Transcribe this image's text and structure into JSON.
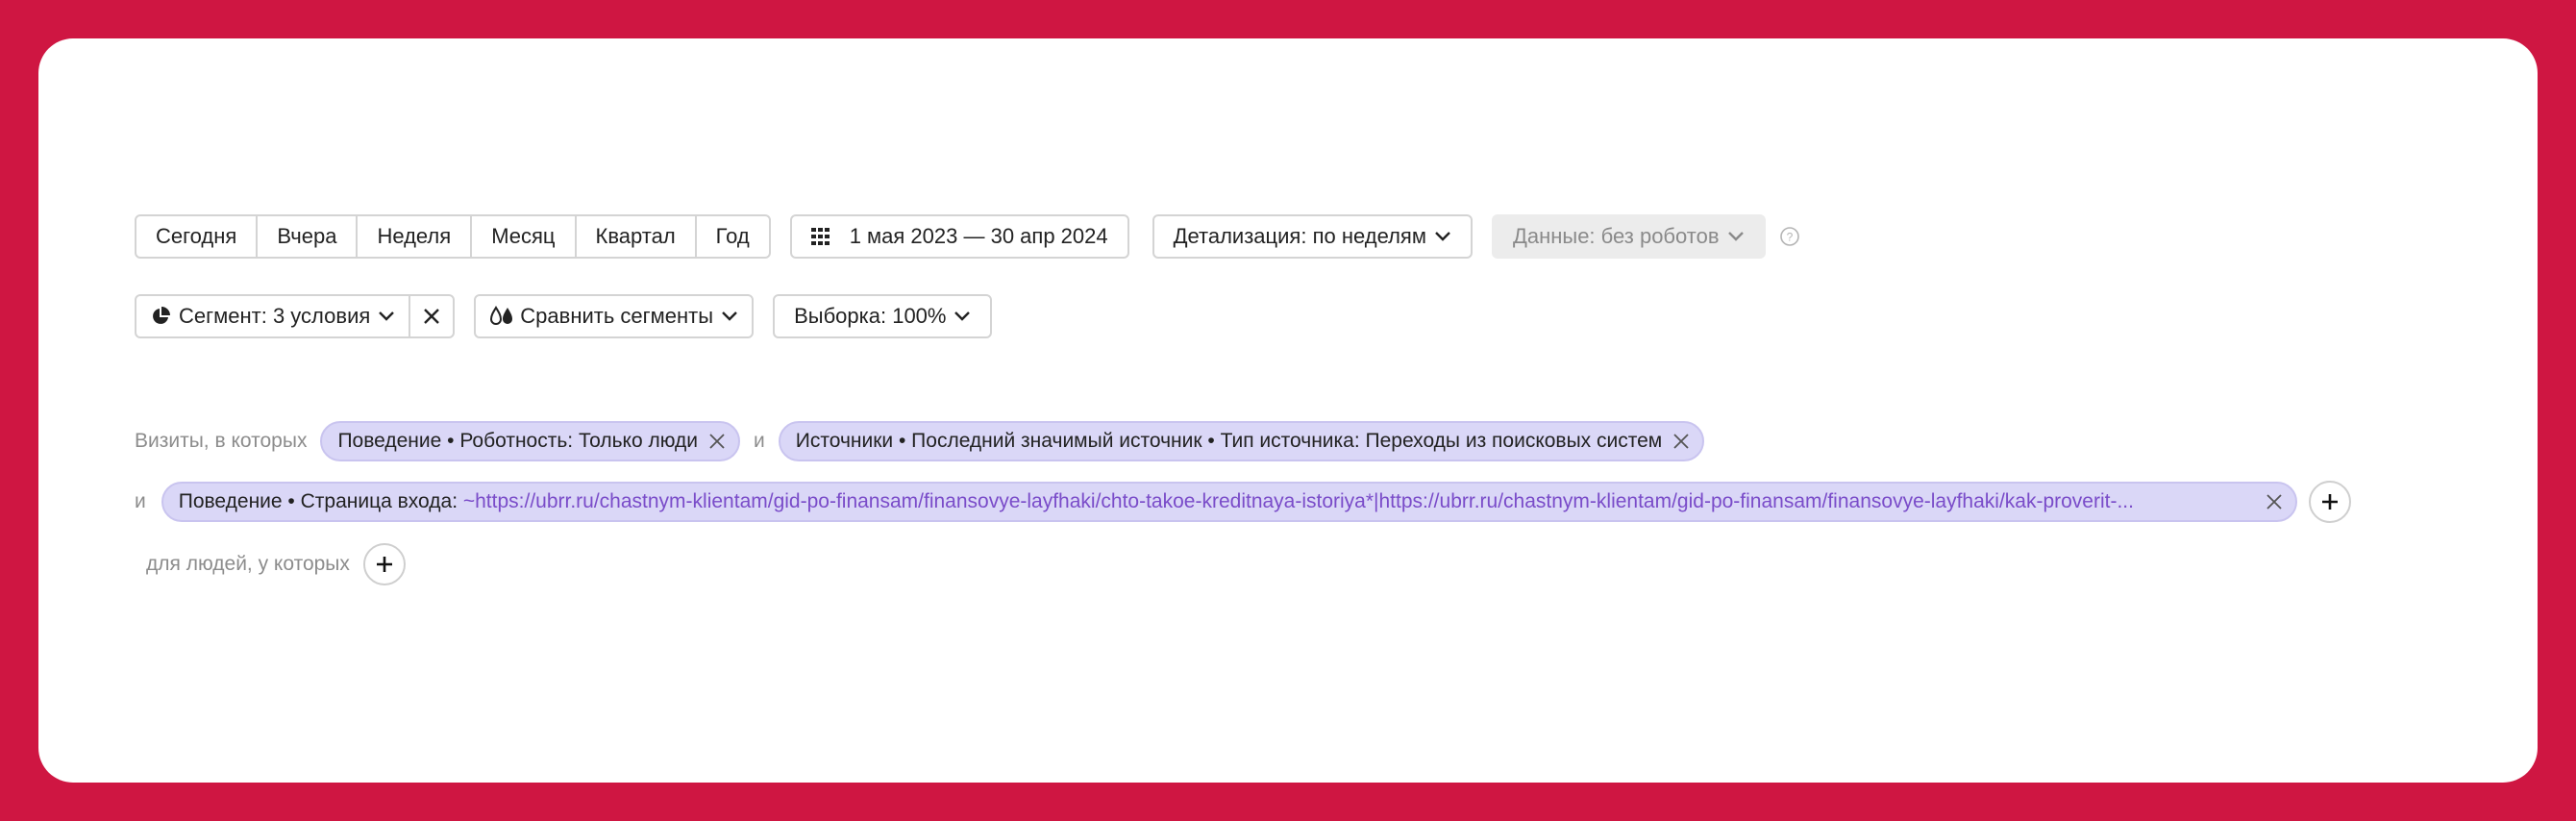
{
  "period_tabs": [
    "Сегодня",
    "Вчера",
    "Неделя",
    "Месяц",
    "Квартал",
    "Год"
  ],
  "date_range": "1 мая 2023 — 30 апр 2024",
  "detail_label": "Детализация: по неделям",
  "data_label": "Данные: без роботов",
  "segment_label": "Сегмент: 3 условия",
  "compare_label": "Сравнить сегменты",
  "sample_label": "Выборка: 100%",
  "visits_label": "Визиты, в которых",
  "and_label": "и",
  "people_label": "для людей, у которых",
  "conditions": {
    "c1": "Поведение • Роботность: Только люди",
    "c2": "Источники • Последний значимый источник • Тип источника: Переходы из поисковых систем",
    "c3_prefix": "Поведение • Страница входа: ",
    "c3_value": "~https://ubrr.ru/chastnym-klientam/gid-po-finansam/finansovye-layfhaki/chto-takoe-kreditnaya-istoriya*|https://ubrr.ru/chastnym-klientam/gid-po-finansam/finansovye-layfhaki/kak-proverit-..."
  },
  "colors": {
    "background": "#cf1642",
    "chip_bg": "#dad7f7",
    "link": "#7a4cc9"
  }
}
